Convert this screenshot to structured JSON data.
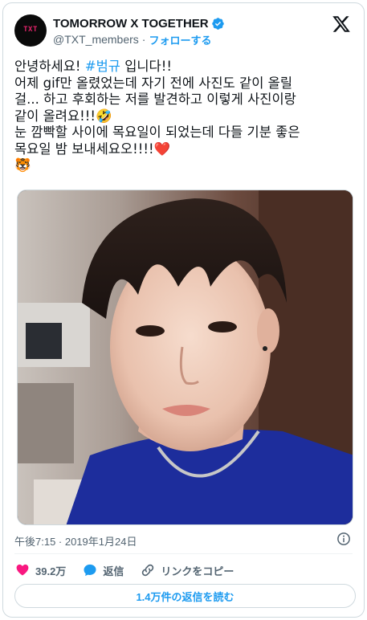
{
  "author": {
    "display_name": "TOMORROW X TOGETHER",
    "handle": "@TXT_members",
    "separator": "·",
    "follow_label": "フォローする",
    "avatar_logo_text": "TXT",
    "verified": true
  },
  "tweet": {
    "lines": [
      {
        "before": "안녕하세요! ",
        "hashtag": "#범규",
        "after": " 입니다!!"
      },
      {
        "text": "어제 gif만 올렸었는데 자기 전에 사진도 같이 올릴"
      },
      {
        "text": "걸... 하고 후회하는 저를 발견하고 이렇게 사진이랑"
      },
      {
        "text": "같이 올려요!!!🤣"
      },
      {
        "text": "눈 깜빡할 사이에 목요일이 되었는데 다들 기분 좋은"
      },
      {
        "text": "목요일 밤 보내세요오!!!!❤️"
      },
      {
        "text": "🐯"
      }
    ]
  },
  "media": {
    "icon": "selfie-photo"
  },
  "meta": {
    "timestamp": "午後7:15 · 2019年1月24日"
  },
  "actions": {
    "likes_count": "39.2万",
    "reply_label": "返信",
    "copy_link_label": "リンクをコピー"
  },
  "replies_button": {
    "label": "1.4万件の返信を読む"
  },
  "colors": {
    "accent": "#1d9bf0",
    "like": "#f91880",
    "muted": "#536471"
  }
}
